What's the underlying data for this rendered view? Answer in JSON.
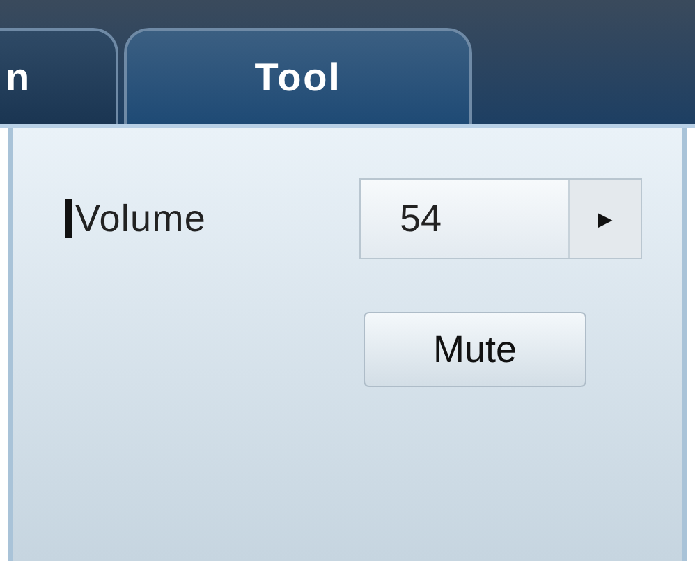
{
  "tabs": [
    {
      "label": "n",
      "selected": false
    },
    {
      "label": "Tool",
      "selected": true
    }
  ],
  "volume": {
    "label": "Volume",
    "value": "54",
    "arrow": "▶"
  },
  "buttons": [
    "Mute"
  ]
}
